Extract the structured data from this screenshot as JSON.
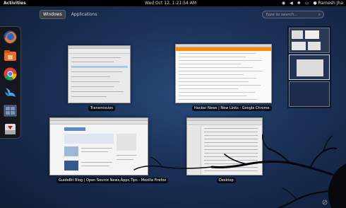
{
  "topbar": {
    "activities": "Activities",
    "clock": "Wed Oct 12,  1:21:54 AM",
    "user": "Ramesh Jha",
    "status_icons": [
      "network-icon",
      "volume-icon",
      "bluetooth-icon",
      "battery-icon"
    ]
  },
  "tabs": [
    {
      "label": "Windows",
      "active": true
    },
    {
      "label": "Applications",
      "active": false
    }
  ],
  "search": {
    "placeholder": "Type to search..."
  },
  "dash": {
    "items": [
      "firefox-icon",
      "files-icon",
      "chrome-icon",
      "flock-icon",
      "workspace-icon",
      "transmission-icon"
    ]
  },
  "windows": [
    {
      "caption": "Transmission"
    },
    {
      "caption": "Hacker News | New Links - Google Chrome"
    },
    {
      "caption": "GuideBit Blog | Open Source News,Apps,Tips - Mozilla Firefox"
    },
    {
      "caption": "Desktop"
    }
  ],
  "colors": {
    "background": "#1b3157",
    "topbar": "#000000",
    "accent": "#ff8a00"
  }
}
